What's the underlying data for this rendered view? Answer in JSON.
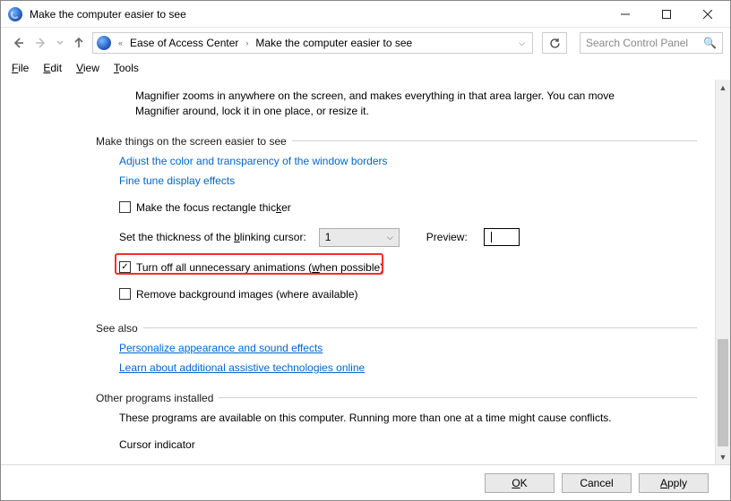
{
  "window": {
    "title": "Make the computer easier to see"
  },
  "breadcrumb": {
    "item1": "Ease of Access Center",
    "item2": "Make the computer easier to see"
  },
  "search": {
    "placeholder": "Search Control Panel"
  },
  "menu": {
    "file": "File",
    "edit": "Edit",
    "view": "View",
    "tools": "Tools"
  },
  "intro": "Magnifier zooms in anywhere on the screen, and makes everything in that area larger. You can move Magnifier around, lock it in one place, or resize it.",
  "section1": {
    "heading": "Make things on the screen easier to see",
    "link_color": "Adjust the color and transparency of the window borders",
    "link_fine": "Fine tune display effects",
    "chk_focus": "Make the focus rectangle thicker",
    "cursor_label": "Set the thickness of the blinking cursor:",
    "cursor_value": "1",
    "preview_label": "Preview:",
    "chk_anim": "Turn off all unnecessary animations (when possible)",
    "chk_bg": "Remove background images (where available)"
  },
  "seealso": {
    "heading": "See also",
    "link1": "Personalize appearance and sound effects",
    "link2": "Learn about additional assistive technologies online"
  },
  "other": {
    "heading": "Other programs installed",
    "desc": "These programs are available on this computer. Running more than one at a time might cause conflicts.",
    "item1": "Cursor indicator"
  },
  "footer": {
    "ok": "OK",
    "cancel": "Cancel",
    "apply": "Apply"
  }
}
